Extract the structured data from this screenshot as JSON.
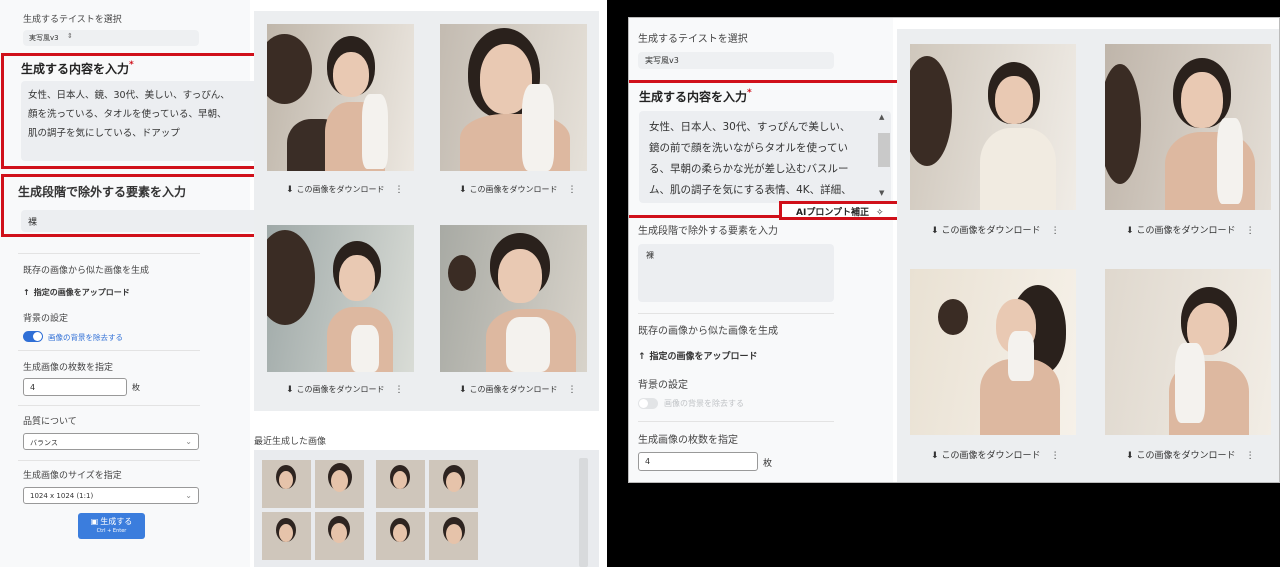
{
  "left": {
    "taste_label": "生成するテイストを選択",
    "taste_value": "実写風v3",
    "taste_chev": "⇕",
    "content_label": "生成する内容を入力",
    "required_mark": "*",
    "content_text_lines": [
      "女性、日本人、鏡、30代、美しい、すっぴん、",
      "顔を洗っている、タオルを使っている、早朝、",
      "肌の調子を気にしている、ドアップ"
    ],
    "negative_label": "生成段階で除外する要素を入力",
    "negative_value": "裸",
    "similar_label": "既存の画像から似た画像を生成",
    "upload_label": "指定の画像をアップロード",
    "upload_icon": "↑",
    "bg_label": "背景の設定",
    "bg_toggle_label": "画像の背景を除去する",
    "count_label": "生成画像の枚数を指定",
    "count_value": "4",
    "count_unit": "枚",
    "quality_label": "品質について",
    "quality_value": "バランス",
    "size_label": "生成画像のサイズを指定",
    "size_value": "1024 x 1024 (1:1)",
    "generate_label": "生成する",
    "generate_icon": "▣",
    "generate_shortcut": "Ctrl + Enter",
    "download_label": "この画像をダウンロード",
    "download_icon": "⬇",
    "more_icon": "⋮",
    "recent_label": "最近生成した画像"
  },
  "right": {
    "taste_label": "生成するテイストを選択",
    "taste_value": "実写風v3",
    "content_label": "生成する内容を入力",
    "required_mark": "*",
    "content_text_lines": [
      "女性、日本人、30代、すっぴんで美しい、",
      "鏡の前で顔を洗いながらタオルを使ってい",
      "る、早朝の柔らかな光が差し込むバスルー",
      "ム、肌の調子を気にする表情、4K、詳細、"
    ],
    "ai_button_label": "AIプロンプト補正",
    "ai_icon": "✧",
    "negative_label": "生成段階で除外する要素を入力",
    "negative_value": "裸",
    "similar_label": "既存の画像から似た画像を生成",
    "upload_label": "指定の画像をアップロード",
    "upload_icon": "↑",
    "bg_label": "背景の設定",
    "bg_toggle_label": "画像の背景を除去する",
    "count_label": "生成画像の枚数を指定",
    "count_value": "4",
    "count_unit": "枚",
    "download_label": "この画像をダウンロード",
    "download_icon": "⬇",
    "more_icon": "⋮",
    "scroll_up": "▲",
    "scroll_down": "▼"
  },
  "colors": {
    "accent": "#2f6fd6",
    "highlight_red": "#d0101a",
    "button_blue": "#3b7ddd"
  }
}
